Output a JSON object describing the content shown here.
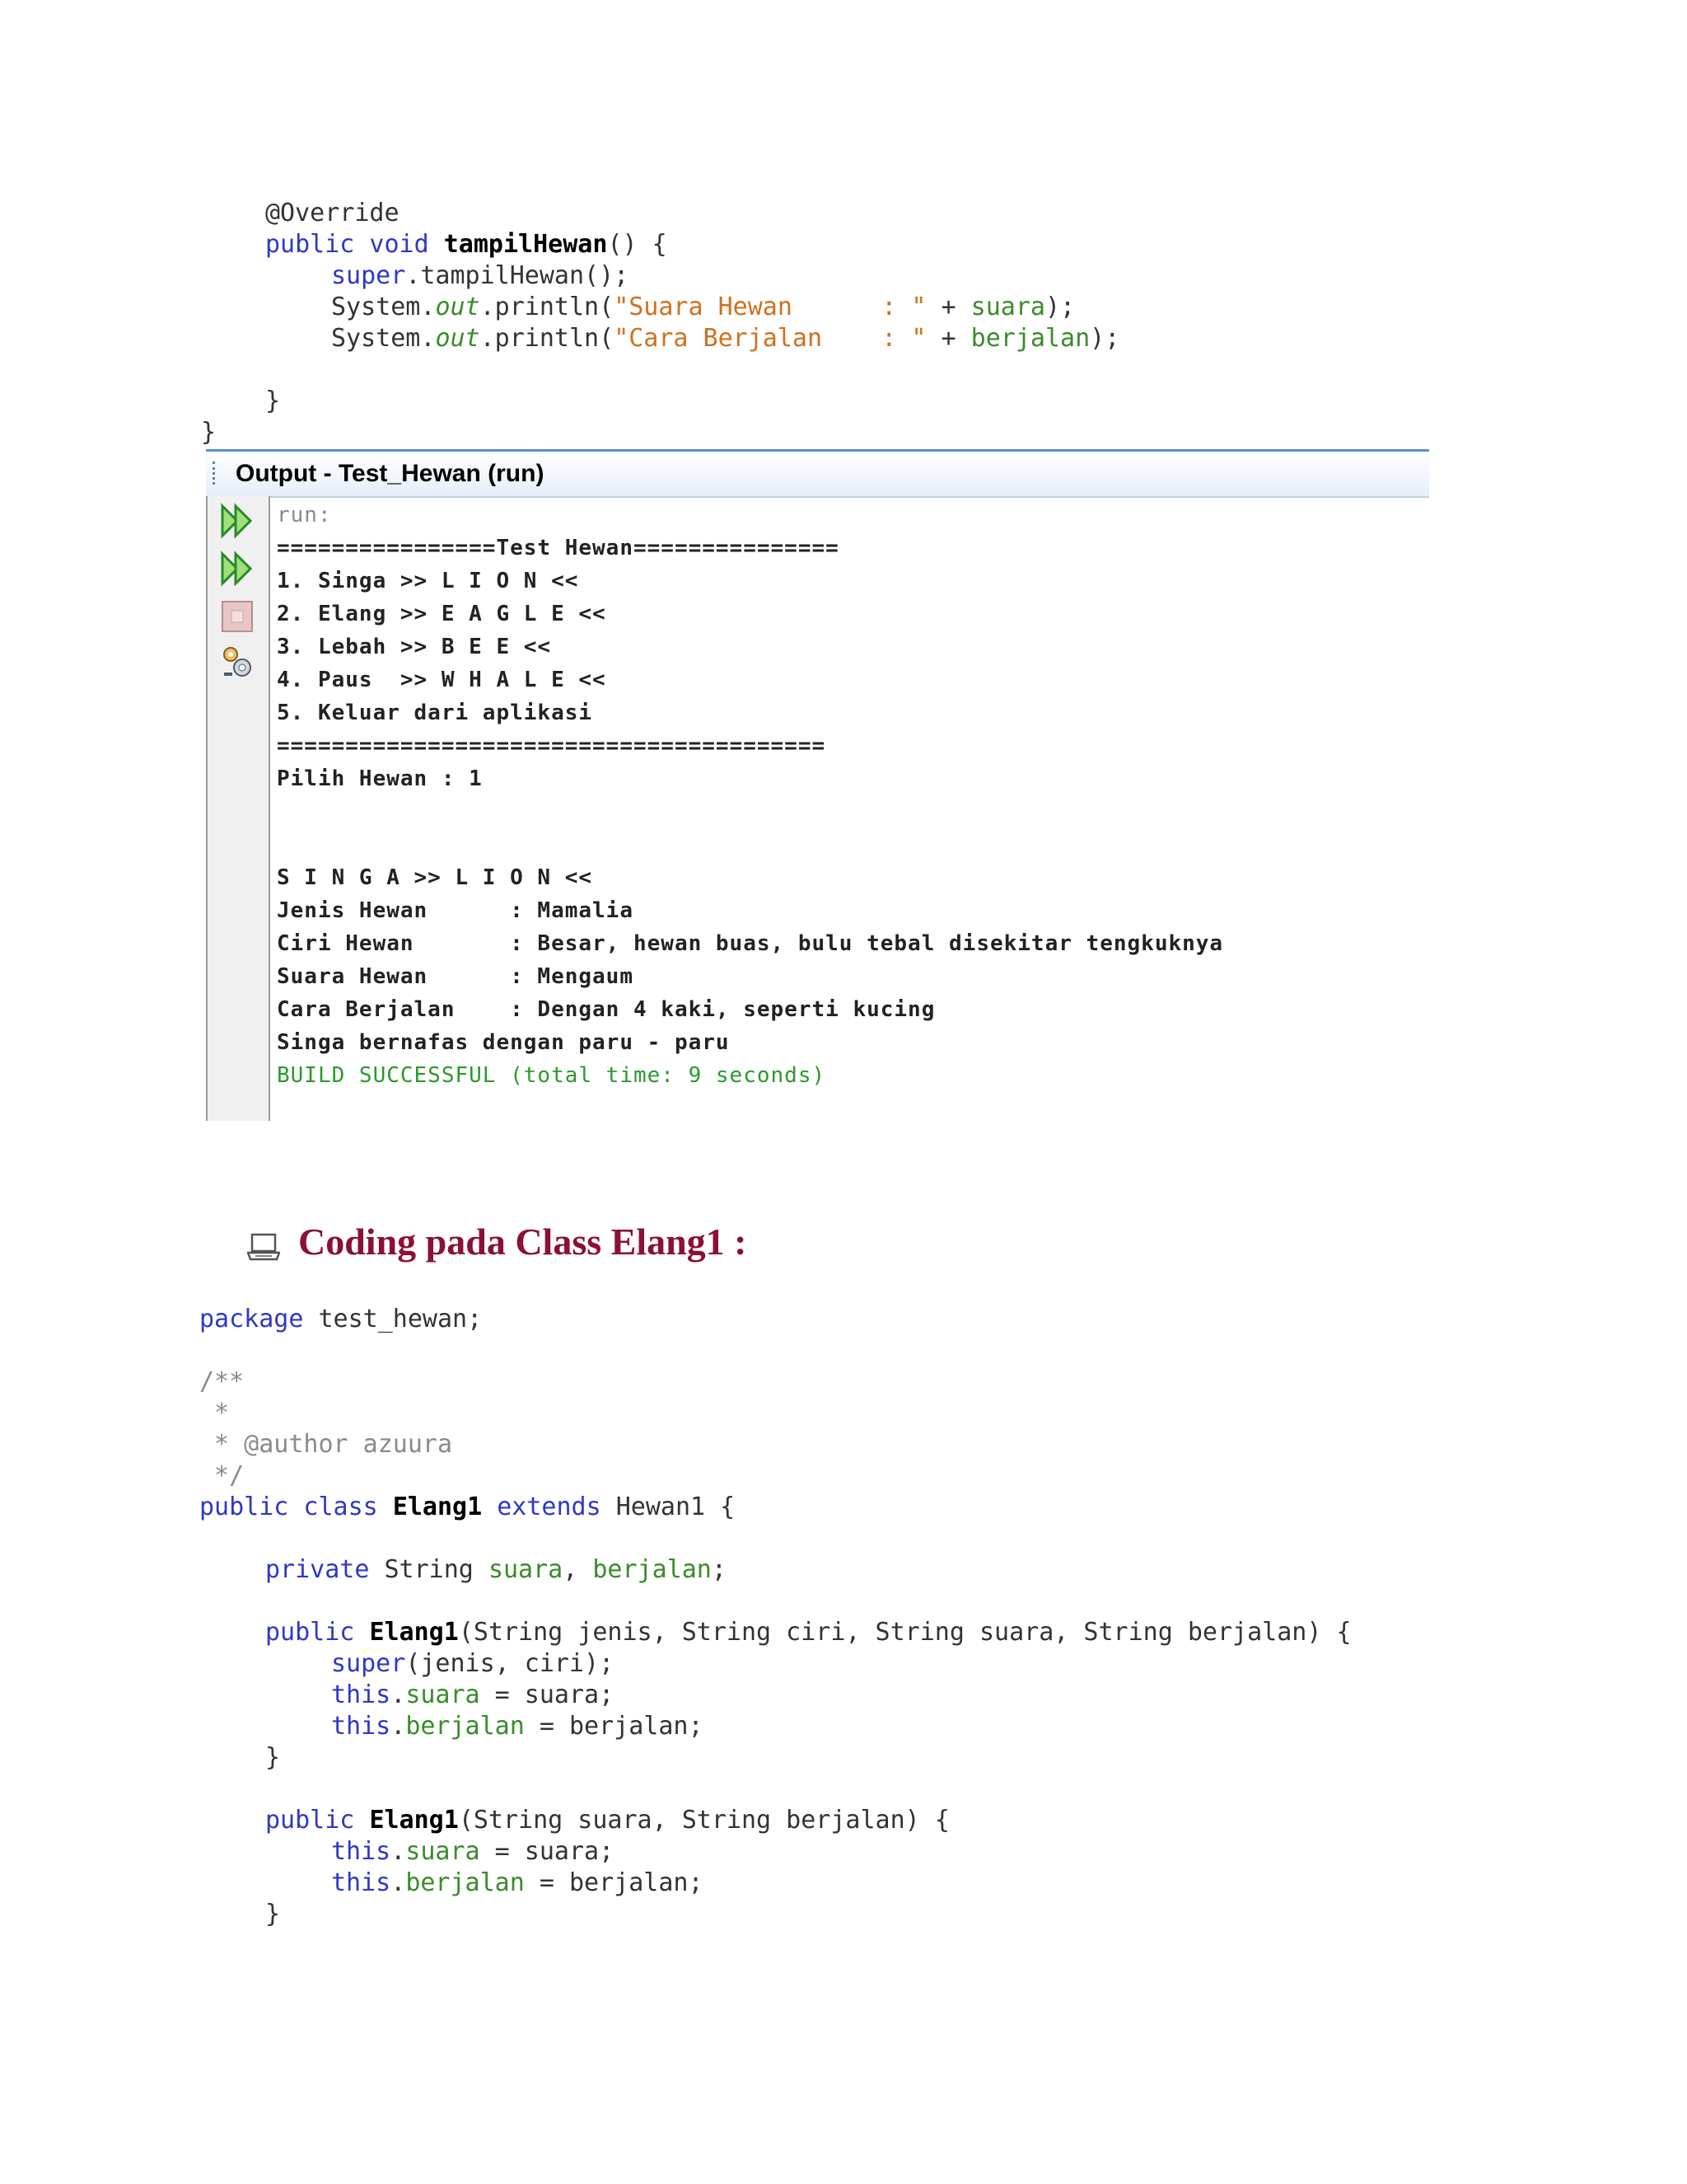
{
  "code_top": {
    "lines": [
      "@Override",
      "public void tampilHewan() {",
      "super.tampilHewan();",
      "System.out.println(\"Suara Hewan      : \" + suara);",
      "System.out.println(\"Cara Berjalan    : \" + berjalan);",
      "}",
      "}"
    ]
  },
  "output": {
    "title": "Output - Test_Hewan (run)",
    "run_label": "run:",
    "lines": [
      "================Test Hewan===============",
      "1. Singa >> L I O N <<",
      "2. Elang >> E A G L E <<",
      "3. Lebah >> B E E <<",
      "4. Paus  >> W H A L E <<",
      "5. Keluar dari aplikasi",
      "========================================",
      "Pilih Hewan : 1",
      "",
      "",
      "S I N G A >> L I O N <<",
      "Jenis Hewan      : Mamalia",
      "Ciri Hewan       : Besar, hewan buas, bulu tebal disekitar tengkuknya",
      "Suara Hewan      : Mengaum",
      "Cara Berjalan    : Dengan 4 kaki, seperti kucing",
      "Singa bernafas dengan paru - paru"
    ],
    "build": "BUILD SUCCESSFUL (total time: 9 seconds)"
  },
  "section_heading": "Coding pada Class Elang1 :",
  "code_bottom": {
    "package_line": "package test_hewan;",
    "comment": [
      "/**",
      " *",
      " * @author azuura",
      " */"
    ],
    "class_decl": "public class Elang1 extends Hewan1 {",
    "field_decl": "private String suara, berjalan;",
    "ctor1": "public Elang1(String jenis, String ciri, String suara, String berjalan) {",
    "ctor1_body": [
      "super(jenis, ciri);",
      "this.suara = suara;",
      "this.berjalan = berjalan;"
    ],
    "ctor2": "public Elang1(String suara, String berjalan) {",
    "ctor2_body": [
      "this.suara = suara;",
      "this.berjalan = berjalan;"
    ],
    "close_brace": "}"
  },
  "colors": {
    "keyword": "#2d38c8",
    "field": "#3a8c2a",
    "string": "#d0701d",
    "heading": "#8b1034",
    "build": "#2a9a2a"
  },
  "icons": [
    "rerun-icon",
    "rerun-with-options-icon",
    "stop-icon",
    "settings-icon",
    "laptop-icon"
  ]
}
